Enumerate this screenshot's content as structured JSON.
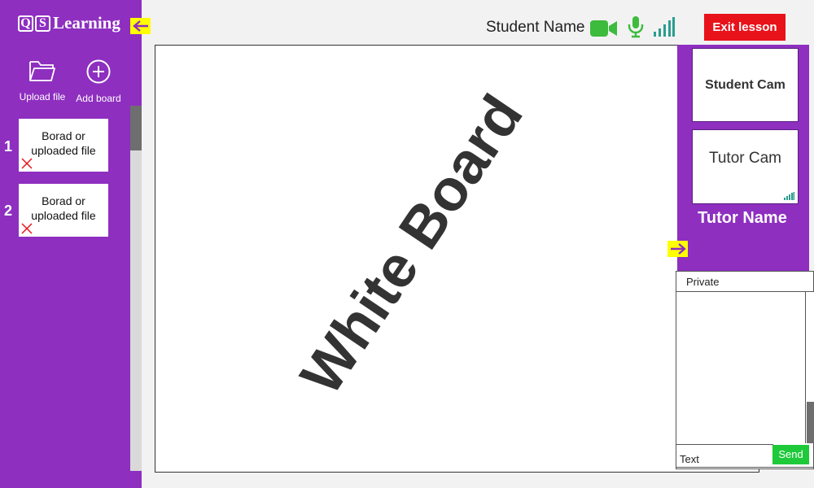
{
  "app": {
    "logo_letters": [
      "Q",
      "S"
    ],
    "logo_text": "Learning"
  },
  "sidebar": {
    "tools": {
      "upload_label": "Upload file",
      "add_label": "Add board"
    },
    "boards": [
      {
        "number": "1",
        "label": "Borad or uploaded file"
      },
      {
        "number": "2",
        "label": "Borad or uploaded file"
      }
    ]
  },
  "header": {
    "student_name": "Student Name",
    "exit_label": "Exit lesson"
  },
  "whiteboard": {
    "label": "White Board"
  },
  "video": {
    "student_cam_label": "Student Cam",
    "tutor_cam_label": "Tutor Cam",
    "tutor_name": "Tutor Name"
  },
  "chat": {
    "tab_label": "Private",
    "input_placeholder": "Text",
    "send_label": "Send"
  },
  "icons": [
    "folder-icon",
    "plus-circle-icon",
    "close-icon",
    "video-camera-icon",
    "microphone-icon",
    "signal-icon",
    "arrow-left-icon",
    "arrow-right-icon"
  ],
  "colors": {
    "sidebar_purple": "#8e2fc0",
    "highlight_yellow": "#ffff00",
    "exit_red": "#e8121b",
    "send_green": "#1ec93a",
    "status_green": "#3dbb3d",
    "signal_teal": "#2a9d8f"
  }
}
